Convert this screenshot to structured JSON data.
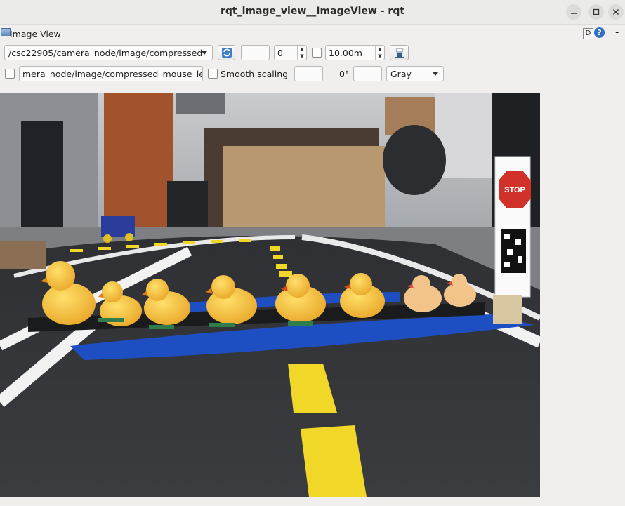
{
  "window": {
    "title": "rqt_image_view__ImageView - rqt"
  },
  "plugin": {
    "title": "Image View",
    "d_label": "D",
    "help_label": "?",
    "close_label": "-"
  },
  "toolbar": {
    "topic": "/csc22905/camera_node/image/compressed",
    "blank_field_1": "",
    "rotation_value": "0",
    "max_range": "10.00m",
    "mouse_topic": "mera_node/image/compressed_mouse_left",
    "smooth_label": "Smooth scaling",
    "blank_field_2": "",
    "angle_label": "0°",
    "blank_field_3": "",
    "colormap": "Gray"
  },
  "image": {
    "stop_sign_text": "STOP",
    "ducks": 8
  }
}
